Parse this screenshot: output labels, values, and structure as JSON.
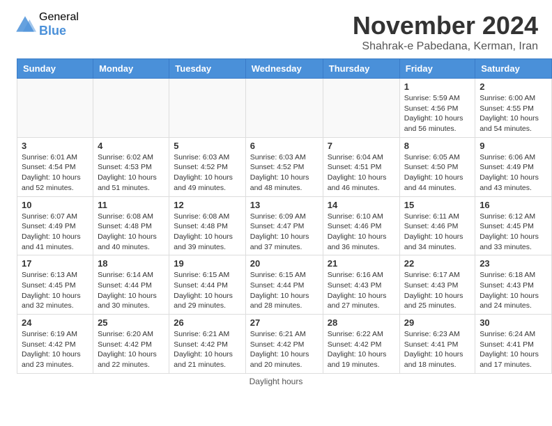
{
  "header": {
    "logo_general": "General",
    "logo_blue": "Blue",
    "month_title": "November 2024",
    "location": "Shahrak-e Pabedana, Kerman, Iran"
  },
  "footer": {
    "daylight_label": "Daylight hours"
  },
  "calendar": {
    "headers": [
      "Sunday",
      "Monday",
      "Tuesday",
      "Wednesday",
      "Thursday",
      "Friday",
      "Saturday"
    ],
    "weeks": [
      [
        {
          "day": "",
          "info": ""
        },
        {
          "day": "",
          "info": ""
        },
        {
          "day": "",
          "info": ""
        },
        {
          "day": "",
          "info": ""
        },
        {
          "day": "",
          "info": ""
        },
        {
          "day": "1",
          "info": "Sunrise: 5:59 AM\nSunset: 4:56 PM\nDaylight: 10 hours\nand 56 minutes."
        },
        {
          "day": "2",
          "info": "Sunrise: 6:00 AM\nSunset: 4:55 PM\nDaylight: 10 hours\nand 54 minutes."
        }
      ],
      [
        {
          "day": "3",
          "info": "Sunrise: 6:01 AM\nSunset: 4:54 PM\nDaylight: 10 hours\nand 52 minutes."
        },
        {
          "day": "4",
          "info": "Sunrise: 6:02 AM\nSunset: 4:53 PM\nDaylight: 10 hours\nand 51 minutes."
        },
        {
          "day": "5",
          "info": "Sunrise: 6:03 AM\nSunset: 4:52 PM\nDaylight: 10 hours\nand 49 minutes."
        },
        {
          "day": "6",
          "info": "Sunrise: 6:03 AM\nSunset: 4:52 PM\nDaylight: 10 hours\nand 48 minutes."
        },
        {
          "day": "7",
          "info": "Sunrise: 6:04 AM\nSunset: 4:51 PM\nDaylight: 10 hours\nand 46 minutes."
        },
        {
          "day": "8",
          "info": "Sunrise: 6:05 AM\nSunset: 4:50 PM\nDaylight: 10 hours\nand 44 minutes."
        },
        {
          "day": "9",
          "info": "Sunrise: 6:06 AM\nSunset: 4:49 PM\nDaylight: 10 hours\nand 43 minutes."
        }
      ],
      [
        {
          "day": "10",
          "info": "Sunrise: 6:07 AM\nSunset: 4:49 PM\nDaylight: 10 hours\nand 41 minutes."
        },
        {
          "day": "11",
          "info": "Sunrise: 6:08 AM\nSunset: 4:48 PM\nDaylight: 10 hours\nand 40 minutes."
        },
        {
          "day": "12",
          "info": "Sunrise: 6:08 AM\nSunset: 4:48 PM\nDaylight: 10 hours\nand 39 minutes."
        },
        {
          "day": "13",
          "info": "Sunrise: 6:09 AM\nSunset: 4:47 PM\nDaylight: 10 hours\nand 37 minutes."
        },
        {
          "day": "14",
          "info": "Sunrise: 6:10 AM\nSunset: 4:46 PM\nDaylight: 10 hours\nand 36 minutes."
        },
        {
          "day": "15",
          "info": "Sunrise: 6:11 AM\nSunset: 4:46 PM\nDaylight: 10 hours\nand 34 minutes."
        },
        {
          "day": "16",
          "info": "Sunrise: 6:12 AM\nSunset: 4:45 PM\nDaylight: 10 hours\nand 33 minutes."
        }
      ],
      [
        {
          "day": "17",
          "info": "Sunrise: 6:13 AM\nSunset: 4:45 PM\nDaylight: 10 hours\nand 32 minutes."
        },
        {
          "day": "18",
          "info": "Sunrise: 6:14 AM\nSunset: 4:44 PM\nDaylight: 10 hours\nand 30 minutes."
        },
        {
          "day": "19",
          "info": "Sunrise: 6:15 AM\nSunset: 4:44 PM\nDaylight: 10 hours\nand 29 minutes."
        },
        {
          "day": "20",
          "info": "Sunrise: 6:15 AM\nSunset: 4:44 PM\nDaylight: 10 hours\nand 28 minutes."
        },
        {
          "day": "21",
          "info": "Sunrise: 6:16 AM\nSunset: 4:43 PM\nDaylight: 10 hours\nand 27 minutes."
        },
        {
          "day": "22",
          "info": "Sunrise: 6:17 AM\nSunset: 4:43 PM\nDaylight: 10 hours\nand 25 minutes."
        },
        {
          "day": "23",
          "info": "Sunrise: 6:18 AM\nSunset: 4:43 PM\nDaylight: 10 hours\nand 24 minutes."
        }
      ],
      [
        {
          "day": "24",
          "info": "Sunrise: 6:19 AM\nSunset: 4:42 PM\nDaylight: 10 hours\nand 23 minutes."
        },
        {
          "day": "25",
          "info": "Sunrise: 6:20 AM\nSunset: 4:42 PM\nDaylight: 10 hours\nand 22 minutes."
        },
        {
          "day": "26",
          "info": "Sunrise: 6:21 AM\nSunset: 4:42 PM\nDaylight: 10 hours\nand 21 minutes."
        },
        {
          "day": "27",
          "info": "Sunrise: 6:21 AM\nSunset: 4:42 PM\nDaylight: 10 hours\nand 20 minutes."
        },
        {
          "day": "28",
          "info": "Sunrise: 6:22 AM\nSunset: 4:42 PM\nDaylight: 10 hours\nand 19 minutes."
        },
        {
          "day": "29",
          "info": "Sunrise: 6:23 AM\nSunset: 4:41 PM\nDaylight: 10 hours\nand 18 minutes."
        },
        {
          "day": "30",
          "info": "Sunrise: 6:24 AM\nSunset: 4:41 PM\nDaylight: 10 hours\nand 17 minutes."
        }
      ]
    ]
  }
}
